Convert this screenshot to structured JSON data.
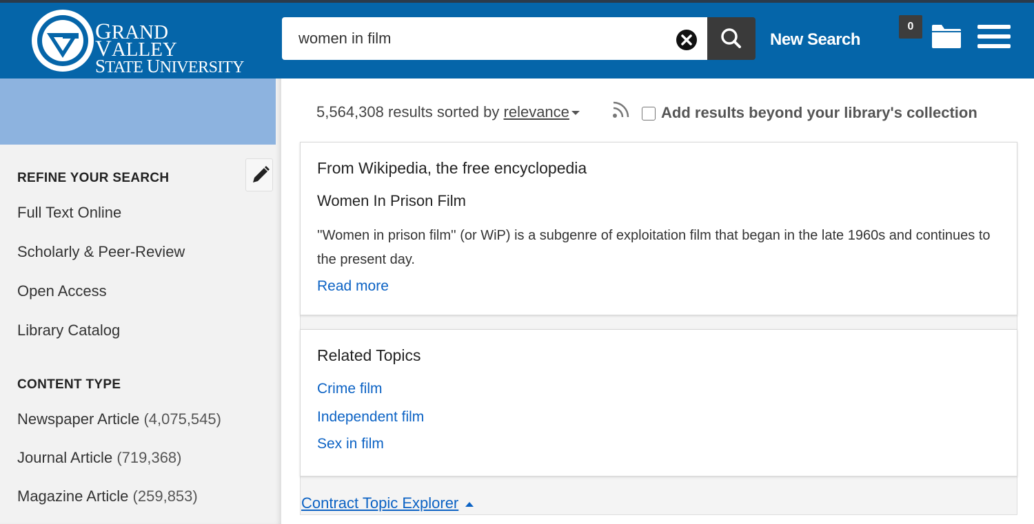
{
  "header": {
    "logo": {
      "line1_big": "G",
      "line1_rest": "RAND ",
      "line1_big2": "V",
      "line1_rest2": "ALLEY",
      "line2_big": "S",
      "line2_rest": "TATE ",
      "line2_big2": "U",
      "line2_rest2": "NIVERSITY"
    },
    "search_value": "women in film",
    "new_search_label": "New Search",
    "folder_count": "0",
    "colors": {
      "header_bg": "#0565a9",
      "search_button": "#3a3a3a",
      "link": "#0b62c4"
    }
  },
  "sidebar": {
    "refine_heading": "REFINE YOUR SEARCH",
    "refine_items": [
      "Full Text Online",
      "Scholarly & Peer-Review",
      "Open Access",
      "Library Catalog"
    ],
    "content_type_heading": "CONTENT TYPE",
    "content_types": [
      {
        "label": "Newspaper Article",
        "count": "(4,075,545)"
      },
      {
        "label": "Journal Article",
        "count": "(719,368)"
      },
      {
        "label": "Magazine Article",
        "count": "(259,853)"
      }
    ]
  },
  "results": {
    "count_text": "5,564,308 results sorted by",
    "sort_label": "relevance",
    "beyond_label": "Add results beyond your library's collection"
  },
  "wiki_card": {
    "source": "From Wikipedia, the free encyclopedia",
    "title": "Women In Prison Film",
    "body": "''Women in prison film'' (or WiP) is a subgenre of exploitation film that began in the late 1960s and continues to the present day.",
    "read_more": "Read more"
  },
  "topics_card": {
    "heading": "Related Topics",
    "topics": [
      "Crime film",
      "Independent film",
      "Sex in film"
    ]
  },
  "contract_label": "Contract Topic Explorer"
}
